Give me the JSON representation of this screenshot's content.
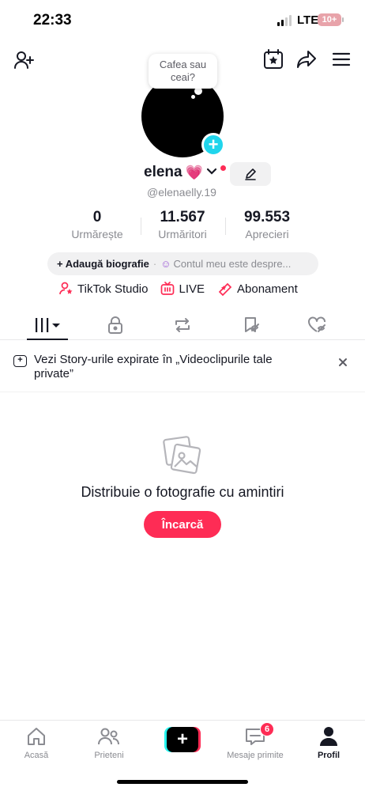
{
  "status_bar": {
    "time": "22:33",
    "network": "LTE",
    "battery": "10+"
  },
  "header": {
    "add_friend_icon": "person-plus-icon",
    "calendar_icon": "calendar-star-icon",
    "share_icon": "share-arrow-icon",
    "menu_icon": "hamburger-menu-icon"
  },
  "profile": {
    "bubble_text": "Cafea sau ceai?",
    "name": "elena",
    "heart": "💗",
    "handle": "@elenaelly.19",
    "stats": [
      {
        "value": "0",
        "label": "Urmărește"
      },
      {
        "value": "11.567",
        "label": "Urmăritori"
      },
      {
        "value": "99.553",
        "label": "Aprecieri"
      }
    ],
    "bio_add": "+ Adaugă biografie",
    "bio_about": "Contul meu este despre...",
    "links": [
      {
        "label": "TikTok Studio",
        "icon": "person-star-icon"
      },
      {
        "label": "LIVE",
        "icon": "live-tv-icon"
      },
      {
        "label": "Abonament",
        "icon": "star-ticket-icon"
      }
    ]
  },
  "tabs": [
    "videos-grid-icon",
    "lock-icon",
    "repost-icon",
    "favorites-hidden-icon",
    "liked-hidden-icon"
  ],
  "notice": {
    "text": "Vezi Story-urile expirate în „Videoclipurile tale private”",
    "icon": "story-plus-icon"
  },
  "empty_state": {
    "icon": "photos-icon",
    "title": "Distribuie o fotografie cu amintiri",
    "button": "Încarcă"
  },
  "bottom_nav": {
    "items": [
      {
        "label": "Acasă",
        "icon": "home-icon"
      },
      {
        "label": "Prieteni",
        "icon": "friends-icon"
      },
      {
        "label": "",
        "icon": "create-plus-icon"
      },
      {
        "label": "Mesaje primite",
        "icon": "inbox-icon"
      },
      {
        "label": "Profil",
        "icon": "profile-icon"
      }
    ],
    "inbox_badge": "6"
  },
  "colors": {
    "accent": "#fe2c55",
    "cyan": "#25f4ee",
    "avatar_plus": "#20d5ec",
    "text": "#161823",
    "muted": "#8a8b91"
  }
}
